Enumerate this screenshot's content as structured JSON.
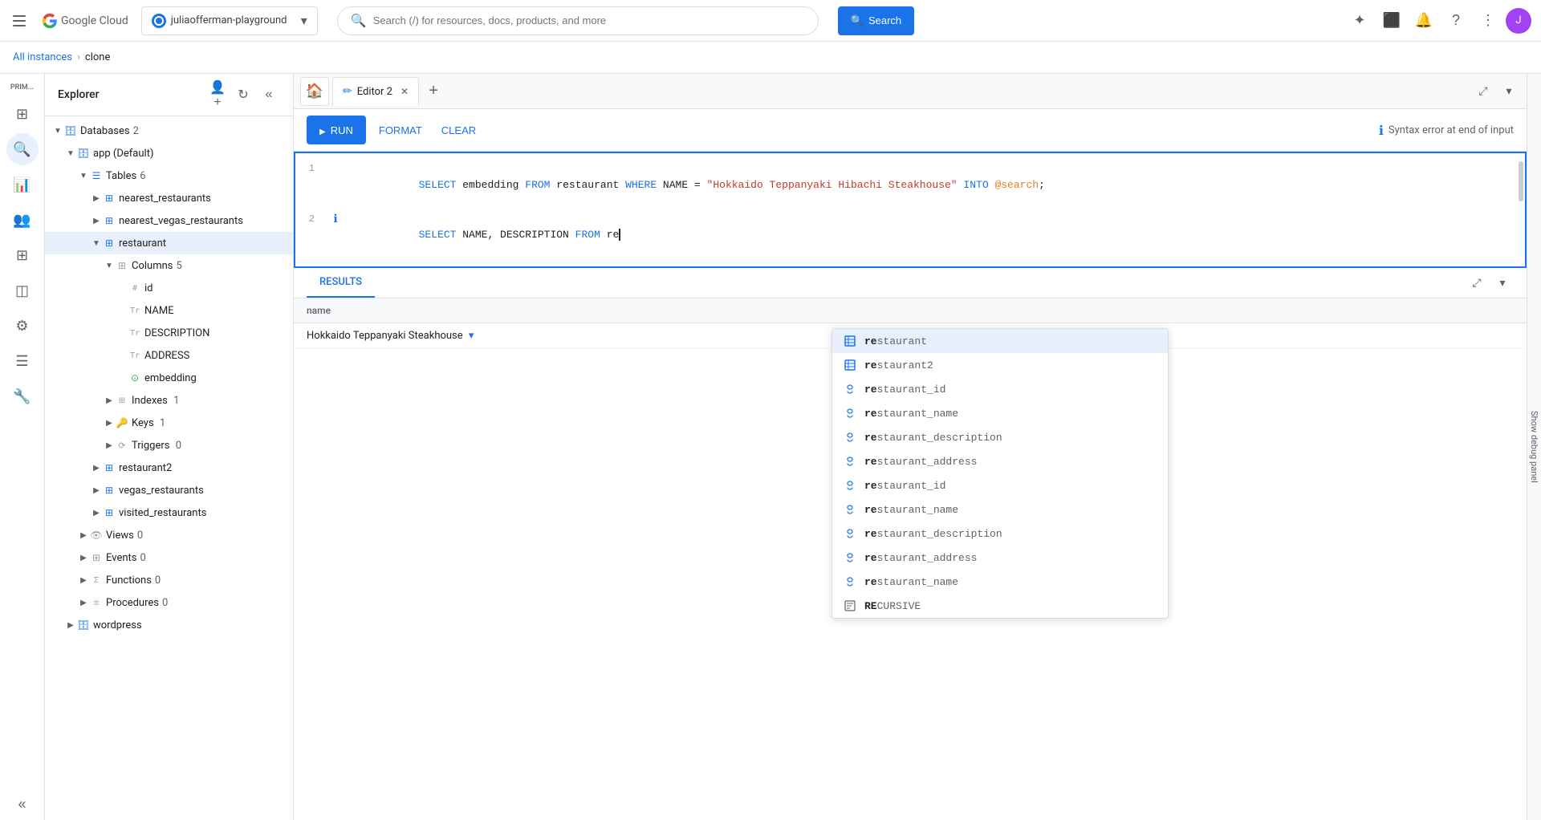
{
  "topNav": {
    "hamburger_label": "Main menu",
    "logo_text": "Google Cloud",
    "project_name": "juliaofferman-playground",
    "project_chevron": "▾",
    "search_placeholder": "Search (/) for resources, docs, products, and more",
    "search_btn_label": "Search",
    "icon_star": "✦",
    "icon_terminal": "⬜",
    "icon_bell": "🔔",
    "icon_help": "?",
    "icon_dots": "⋮",
    "avatar_initials": "J"
  },
  "secondNav": {
    "breadcrumb_all": "All instances",
    "breadcrumb_sep": "›",
    "breadcrumb_current": "clone"
  },
  "sidebar": {
    "prim_label": "PRIM...",
    "icons": [
      {
        "name": "home-icon",
        "symbol": "⊞",
        "active": false
      },
      {
        "name": "search-sidebar-icon",
        "symbol": "🔍",
        "active": true
      },
      {
        "name": "monitoring-icon",
        "symbol": "📊",
        "active": false
      },
      {
        "name": "users-icon",
        "symbol": "👥",
        "active": false
      },
      {
        "name": "table-icon",
        "symbol": "⊞",
        "active": false
      },
      {
        "name": "database-icon",
        "symbol": "🗄",
        "active": false
      },
      {
        "name": "settings-icon",
        "symbol": "⚙",
        "active": false
      },
      {
        "name": "list-icon",
        "symbol": "☰",
        "active": false
      },
      {
        "name": "tools-icon",
        "symbol": "🔧",
        "active": false
      }
    ]
  },
  "explorer": {
    "title": "Explorer",
    "actions": {
      "add_user": "person+",
      "refresh": "↻",
      "collapse": "«"
    },
    "tree": {
      "databases_label": "Databases",
      "databases_count": "2",
      "app_label": "app (Default)",
      "tables_label": "Tables",
      "tables_count": "6",
      "tables": [
        {
          "name": "nearest_restaurants"
        },
        {
          "name": "nearest_vegas_restaurants"
        },
        {
          "name": "restaurant",
          "selected": true,
          "columns_label": "Columns",
          "columns_count": "5",
          "columns": [
            {
              "type": "hash",
              "name": "id"
            },
            {
              "type": "text",
              "name": "NAME"
            },
            {
              "type": "text",
              "name": "DESCRIPTION"
            },
            {
              "type": "text",
              "name": "ADDRESS"
            },
            {
              "type": "embed",
              "name": "embedding"
            }
          ],
          "indexes_label": "Indexes",
          "indexes_count": "1",
          "keys_label": "Keys",
          "keys_count": "1",
          "triggers_label": "Triggers",
          "triggers_count": "0"
        },
        {
          "name": "restaurant2"
        },
        {
          "name": "vegas_restaurants"
        },
        {
          "name": "visited_restaurants"
        }
      ],
      "views_label": "Views",
      "views_count": "0",
      "events_label": "Events",
      "events_count": "0",
      "functions_label": "Functions",
      "functions_count": "0",
      "procedures_label": "Procedures",
      "procedures_count": "0"
    },
    "wordpress": {
      "name": "wordpress"
    }
  },
  "tabs": {
    "home_label": "🏠",
    "editor_label": "Editor 2",
    "add_label": "+",
    "expand_icon": "⤢",
    "chevron_down": "▾"
  },
  "toolbar": {
    "run_label": "RUN",
    "format_label": "FORMAT",
    "clear_label": "CLEAR",
    "error_text": "Syntax error at end of input"
  },
  "editor": {
    "lines": [
      {
        "num": "1",
        "has_info": false,
        "content_parts": [
          {
            "type": "kw",
            "text": "SELECT"
          },
          {
            "type": "plain",
            "text": " embedding "
          },
          {
            "type": "kw",
            "text": "FROM"
          },
          {
            "type": "plain",
            "text": " restaurant "
          },
          {
            "type": "kw",
            "text": "WHERE"
          },
          {
            "type": "plain",
            "text": " NAME = "
          },
          {
            "type": "str",
            "text": "\"Hokkaido Teppanyaki Hibachi Steakhouse\""
          },
          {
            "type": "plain",
            "text": " "
          },
          {
            "type": "kw",
            "text": "INTO"
          },
          {
            "type": "plain",
            "text": " "
          },
          {
            "type": "var",
            "text": "@search"
          },
          {
            "type": "plain",
            "text": ";"
          }
        ]
      },
      {
        "num": "2",
        "has_info": true,
        "content_parts": [
          {
            "type": "kw",
            "text": "SELECT"
          },
          {
            "type": "plain",
            "text": " NAME, DESCRIPTION "
          },
          {
            "type": "kw",
            "text": "FROM"
          },
          {
            "type": "plain",
            "text": " re"
          },
          {
            "type": "cursor",
            "text": ""
          }
        ]
      }
    ]
  },
  "autocomplete": {
    "items": [
      {
        "icon": "table",
        "prefix": "re",
        "rest": "staurant",
        "full": "restaurant",
        "selected": true
      },
      {
        "icon": "table",
        "prefix": "re",
        "rest": "staurant2",
        "full": "restaurant2",
        "selected": false
      },
      {
        "icon": "col",
        "prefix": "re",
        "rest": "staurant_id",
        "full": "restaurant_id",
        "selected": false
      },
      {
        "icon": "col",
        "prefix": "re",
        "rest": "staurant_name",
        "full": "restaurant_name",
        "selected": false
      },
      {
        "icon": "col",
        "prefix": "re",
        "rest": "staurant_description",
        "full": "restaurant_description",
        "selected": false
      },
      {
        "icon": "col",
        "prefix": "re",
        "rest": "staurant_address",
        "full": "restaurant_address",
        "selected": false
      },
      {
        "icon": "col",
        "prefix": "re",
        "rest": "staurant_id",
        "full": "restaurant_id",
        "selected": false
      },
      {
        "icon": "col",
        "prefix": "re",
        "rest": "staurant_name",
        "full": "restaurant_name",
        "selected": false
      },
      {
        "icon": "col",
        "prefix": "re",
        "rest": "staurant_description",
        "full": "restaurant_description",
        "selected": false
      },
      {
        "icon": "col",
        "prefix": "re",
        "rest": "staurant_address",
        "full": "restaurant_address",
        "selected": false
      },
      {
        "icon": "col",
        "prefix": "re",
        "rest": "staurant_name",
        "full": "restaurant_name",
        "selected": false
      },
      {
        "icon": "recursive",
        "prefix": "RE",
        "rest": "CURSIVE",
        "full": "RECURSIVE",
        "selected": false
      }
    ]
  },
  "results": {
    "tab_results": "RESULTS",
    "columns": [
      "name"
    ],
    "rows": [
      [
        "Hokkaido Teppanyaki Steakhouse"
      ]
    ]
  },
  "rightPanel": {
    "label": "Show debug panel"
  }
}
